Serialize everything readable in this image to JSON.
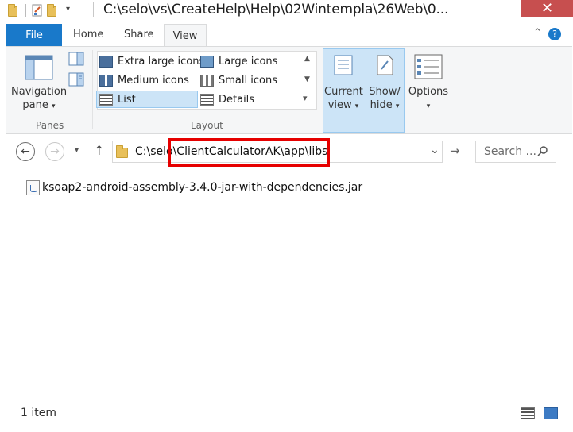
{
  "window": {
    "title": "C:\\selo\\vs\\CreateHelp\\Help\\02Wintempla\\26Web\\0...",
    "minimize": "—",
    "maximize": "☐",
    "close": "✕"
  },
  "ribbon_tabs": {
    "file": "File",
    "home": "Home",
    "share": "Share",
    "view": "View",
    "collapse": "⌃",
    "help": "?"
  },
  "panes": {
    "navigation_pane": "Navigation",
    "navigation_pane_line2": "pane",
    "group_label": "Panes"
  },
  "layout": {
    "extra_large_icons": "Extra large icons",
    "large_icons": "Large icons",
    "medium_icons": "Medium icons",
    "small_icons": "Small icons",
    "list": "List",
    "details": "Details",
    "group_label": "Layout",
    "selected": "List"
  },
  "current_view": {
    "line1": "Current",
    "line2": "view"
  },
  "show_hide": {
    "line1": "Show/",
    "line2": "hide"
  },
  "options": {
    "label": "Options"
  },
  "address_bar": {
    "path": "C:\\selo\\ClientCalculatorAK\\app\\libs",
    "search_placeholder": "Search ..."
  },
  "files": [
    {
      "name": "ksoap2-android-assembly-3.4.0-jar-with-dependencies.jar",
      "type": "jar"
    }
  ],
  "status_bar": {
    "count": "1 item"
  },
  "colors": {
    "file_tab": "#1979ca",
    "close_button": "#c74f4f",
    "selection": "#cce4f7",
    "highlight_box": "#e60000",
    "ribbon_bg": "#f5f6f7"
  }
}
